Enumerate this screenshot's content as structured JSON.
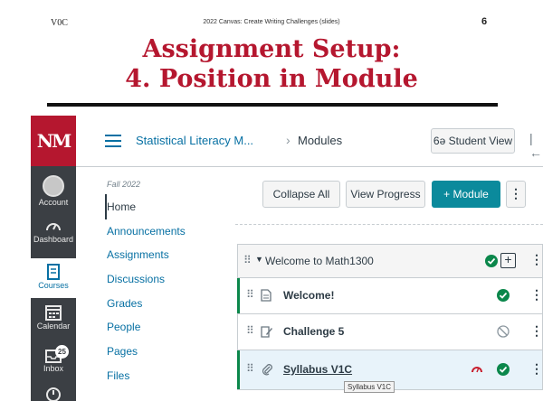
{
  "slide": {
    "version": "V0C",
    "header": "2022 Canvas: Create Writing Challenges (slides)",
    "page_number": "6",
    "title_line1": "Assignment Setup:",
    "title_line2": "4. Position in Module"
  },
  "global_nav": {
    "logo": "NM",
    "items": [
      {
        "label": "Account",
        "icon": "account-icon"
      },
      {
        "label": "Dashboard",
        "icon": "dashboard-icon"
      },
      {
        "label": "Courses",
        "icon": "courses-icon"
      },
      {
        "label": "Calendar",
        "icon": "calendar-icon"
      },
      {
        "label": "Inbox",
        "icon": "inbox-icon",
        "badge": "25"
      }
    ]
  },
  "topbar": {
    "course": "Statistical Literacy M...",
    "separator": "›",
    "current": "Modules",
    "student_view": "Student View",
    "student_view_glyph": "6ə",
    "collapse_glyph": "|←"
  },
  "course_nav": {
    "term": "Fall 2022",
    "items": [
      "Home",
      "Announcements",
      "Assignments",
      "Discussions",
      "Grades",
      "People",
      "Pages",
      "Files"
    ],
    "active": "Home"
  },
  "toolbar": {
    "collapse_all": "Collapse All",
    "view_progress": "View Progress",
    "add_module": "+ Module",
    "more": "⋮"
  },
  "module": {
    "title": "Welcome to Math1300",
    "items": [
      {
        "title": "Welcome!",
        "type": "page-icon",
        "status": "published"
      },
      {
        "title": "Challenge 5",
        "type": "assignment-icon",
        "status": "unpublished"
      },
      {
        "title": "Syllabus V1C",
        "type": "attachment-icon",
        "status": "published"
      }
    ]
  },
  "tooltip": "Syllabus V1C",
  "colors": {
    "brand_red": "#b5172f",
    "link_blue": "#0770a3",
    "teal_button": "#0b8a9c",
    "published_green": "#0b874b",
    "nav_dark": "#3b3f44"
  }
}
